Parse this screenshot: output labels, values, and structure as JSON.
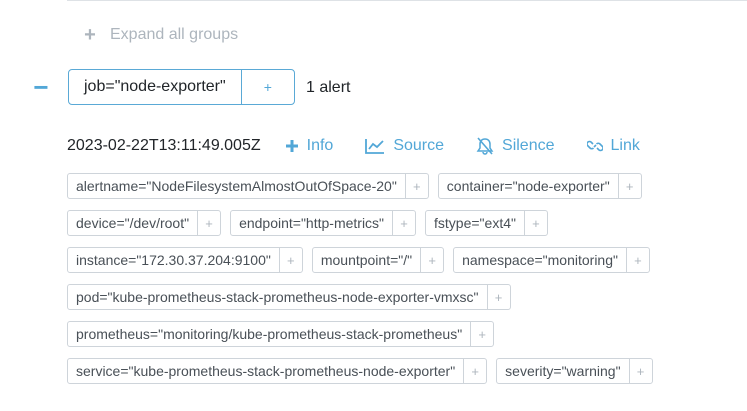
{
  "expand_all": {
    "icon": "plus-icon",
    "label": "Expand all groups"
  },
  "group": {
    "collapse_icon": "minus-icon",
    "label": "job=\"node-exporter\"",
    "add_symbol": "+",
    "alert_count": "1 alert"
  },
  "alert": {
    "timestamp": "2023-02-22T13:11:49.005Z",
    "actions": [
      {
        "icon": "plus-icon",
        "label": "Info"
      },
      {
        "icon": "chart-line-icon",
        "label": "Source"
      },
      {
        "icon": "bell-slash-icon",
        "label": "Silence"
      },
      {
        "icon": "link-icon",
        "label": "Link"
      }
    ],
    "labels": [
      "alertname=\"NodeFilesystemAlmostOutOfSpace-20\"",
      "container=\"node-exporter\"",
      "device=\"/dev/root\"",
      "endpoint=\"http-metrics\"",
      "fstype=\"ext4\"",
      "instance=\"172.30.37.204:9100\"",
      "mountpoint=\"/\"",
      "namespace=\"monitoring\"",
      "pod=\"kube-prometheus-stack-prometheus-node-exporter-vmxsc\"",
      "prometheus=\"monitoring/kube-prometheus-stack-prometheus\"",
      "service=\"kube-prometheus-stack-prometheus-node-exporter\"",
      "severity=\"warning\""
    ],
    "label_add_symbol": "+"
  },
  "colors": {
    "accent": "#52a7d7",
    "muted": "#adb5bd",
    "border": "#ced4da"
  }
}
